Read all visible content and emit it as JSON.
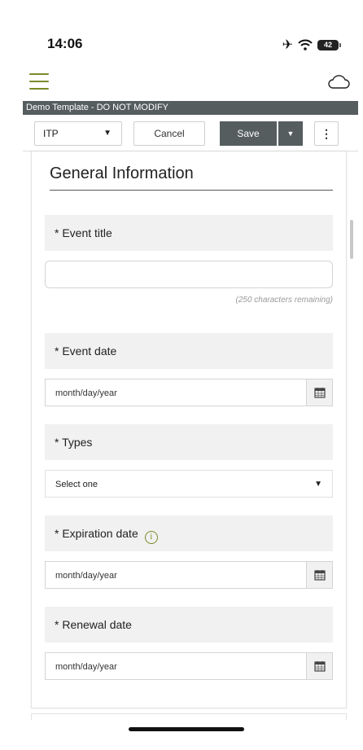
{
  "status_bar": {
    "time": "14:06",
    "battery": "42"
  },
  "header": {
    "template_name": "Demo Template - DO NOT MODIFY"
  },
  "toolbar": {
    "form_select_value": "ITP",
    "cancel_label": "Cancel",
    "save_label": "Save"
  },
  "form": {
    "section_title": "General Information",
    "event_title": {
      "label": "* Event title",
      "value": "",
      "chars_remaining": "(250 characters remaining)"
    },
    "event_date": {
      "label": "* Event date",
      "placeholder": "month/day/year"
    },
    "types": {
      "label": "* Types",
      "selected": "Select one"
    },
    "expiration_date": {
      "label": "* Expiration date",
      "placeholder": "month/day/year"
    },
    "renewal_date": {
      "label": "* Renewal date",
      "placeholder": "month/day/year"
    }
  },
  "colors": {
    "accent": "#7a8a2a",
    "toolbar_dark": "#555d5f",
    "label_bg": "#f1f1f1"
  },
  "icons": [
    "airplane-icon",
    "wifi-icon",
    "battery-icon",
    "menu-icon",
    "cloud-icon",
    "caret-down-icon",
    "more-vertical-icon",
    "calendar-icon",
    "info-icon"
  ]
}
